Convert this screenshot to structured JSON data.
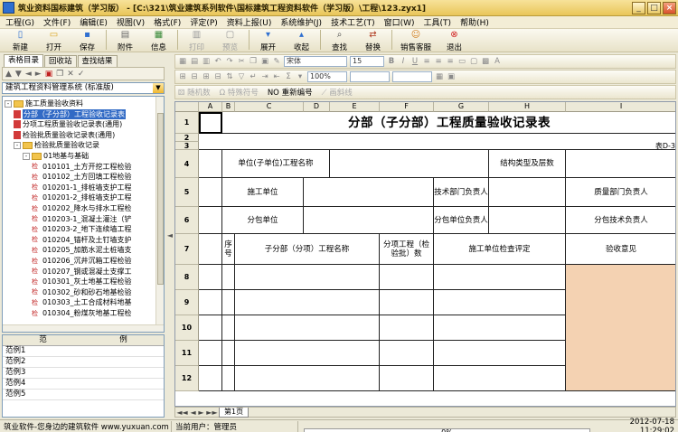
{
  "window": {
    "title": "筑业资料国标建筑（学习版） - [C:\\321\\筑业建筑系列软件\\国标建筑工程资料软件（学习版）\\工程\\123.zyx1]",
    "controls": [
      "_",
      "□",
      "×"
    ]
  },
  "menu": [
    "工程(G)",
    "文件(F)",
    "编辑(E)",
    "视图(V)",
    "格式(F)",
    "评定(P)",
    "资料上报(U)",
    "系统维护(J)",
    "技术工艺(T)",
    "窗口(W)",
    "工具(T)",
    "帮助(H)"
  ],
  "toolbar": [
    {
      "label": "新建",
      "icon": "new-file-icon",
      "glyph": "▯"
    },
    {
      "label": "打开",
      "icon": "open-folder-icon",
      "glyph": "▭"
    },
    {
      "label": "保存",
      "icon": "save-icon",
      "glyph": "▪"
    },
    {
      "label": "附件",
      "icon": "attachment-icon",
      "glyph": "▤"
    },
    {
      "label": "信息",
      "icon": "info-icon",
      "glyph": "▦"
    },
    {
      "label": "打印",
      "icon": "print-icon",
      "glyph": "▥"
    },
    {
      "label": "预览",
      "icon": "preview-icon",
      "glyph": "▢"
    },
    {
      "label": "展开",
      "icon": "expand-icon",
      "glyph": "▾"
    },
    {
      "label": "收起",
      "icon": "collapse-icon",
      "glyph": "▴"
    },
    {
      "label": "查找",
      "icon": "find-icon",
      "glyph": "⌕"
    },
    {
      "label": "替换",
      "icon": "replace-icon",
      "glyph": "⇄"
    },
    {
      "label": "销售客服",
      "icon": "service-icon",
      "glyph": "☺"
    },
    {
      "label": "退出",
      "icon": "exit-icon",
      "glyph": "⊗"
    }
  ],
  "left_panel": {
    "tabs": [
      "表格目录",
      "回收站",
      "查找结果"
    ],
    "tree_root_combo": "建筑工程资料管理系统 (标准版)",
    "tree": [
      {
        "label": "施工质量验收资料",
        "level": 0,
        "type": "folder",
        "toggle": "-"
      },
      {
        "label": "分部（子分部）工程验收记录表",
        "level": 1,
        "type": "doc",
        "selected": true
      },
      {
        "label": "分项工程质量验收记录表(通用)",
        "level": 1,
        "type": "doc"
      },
      {
        "label": "检验批质量验收记录表(通用)",
        "level": 1,
        "type": "doc"
      },
      {
        "label": "检验批质量验收记录",
        "level": 1,
        "type": "folder",
        "toggle": "-"
      },
      {
        "label": "01地基与基础",
        "level": 2,
        "type": "folder",
        "toggle": "-"
      },
      {
        "label": "010101_土方开挖工程检验",
        "level": 3,
        "type": "leaf",
        "mark": "检"
      },
      {
        "label": "010102_土方回填工程检验",
        "level": 3,
        "type": "leaf",
        "mark": "检"
      },
      {
        "label": "010201-1_排桩墙支护工程",
        "level": 3,
        "type": "leaf",
        "mark": "检"
      },
      {
        "label": "010201-2_排桩墙支护工程",
        "level": 3,
        "type": "leaf",
        "mark": "检"
      },
      {
        "label": "010202_降水与排水工程检",
        "level": 3,
        "type": "leaf",
        "mark": "检"
      },
      {
        "label": "010203-1_混凝土灌注（铲",
        "level": 3,
        "type": "leaf",
        "mark": "检"
      },
      {
        "label": "010203-2_地下连续墙工程",
        "level": 3,
        "type": "leaf",
        "mark": "检"
      },
      {
        "label": "010204_锚杆及土钉墙支护",
        "level": 3,
        "type": "leaf",
        "mark": "检"
      },
      {
        "label": "010205_加筋水泥土桩墙支",
        "level": 3,
        "type": "leaf",
        "mark": "检"
      },
      {
        "label": "010206_沉井沉箱工程检验",
        "level": 3,
        "type": "leaf",
        "mark": "检"
      },
      {
        "label": "010207_钢或混凝土支撑工",
        "level": 3,
        "type": "leaf",
        "mark": "检"
      },
      {
        "label": "010301_灰土地基工程检验",
        "level": 3,
        "type": "leaf",
        "mark": "检"
      },
      {
        "label": "010302_砂和砂石地基检验",
        "level": 3,
        "type": "leaf",
        "mark": "检"
      },
      {
        "label": "010303_土工合成材料地基",
        "level": 3,
        "type": "leaf",
        "mark": "检"
      },
      {
        "label": "010304_粉煤灰地基工程检",
        "level": 3,
        "type": "leaf",
        "mark": "检"
      }
    ],
    "examples_header": [
      "范",
      "例"
    ],
    "examples": [
      "范例1",
      "范例2",
      "范例3",
      "范例4",
      "范例5"
    ]
  },
  "format_toolbar": {
    "font": "宋体",
    "size": "15",
    "zoom": "100%",
    "bold": "B",
    "italic": "I",
    "underline": "U",
    "sigma": "Σ",
    "row3": [
      "随机数",
      "特殊符号",
      "重新编号",
      "画斜线"
    ],
    "row3_prefix": "NO"
  },
  "sheet": {
    "columns": [
      "A",
      "B",
      "C",
      "D",
      "E",
      "F",
      "G",
      "H",
      "I"
    ],
    "rows": [
      "1",
      "2",
      "3",
      "4",
      "5",
      "6",
      "7",
      "8",
      "9",
      "10",
      "11",
      "12"
    ],
    "title": "分部（子分部）工程质量验收记录表",
    "form_no": "表D-3",
    "labels": {
      "project_name": "单位(子单位)工程名称",
      "structure_type": "结构类型及层数",
      "construction_unit": "施工单位",
      "tech_head": "技术部门负责人",
      "quality_head": "质量部门负责人",
      "subcontractor": "分包单位",
      "sub_head": "分包单位负责人",
      "sub_tech_head": "分包技术负责人",
      "seq": "序号",
      "sub_project_name": "子分部（分项）工程名称",
      "inspection_count": "分项工程（检验批）数",
      "construction_check": "施工单位检查评定",
      "acceptance": "验收意见"
    },
    "sheet_tab": "第1页",
    "nav": [
      "◄◄",
      "◄",
      "►",
      "►►"
    ]
  },
  "status": {
    "company": "筑业软件-您身边的建筑软件 www.yuxuan.com",
    "user_label": "当前用户：管理员",
    "progress": 0,
    "progress_text": "0%",
    "datetime": "2012-07-18 11:29:02"
  }
}
